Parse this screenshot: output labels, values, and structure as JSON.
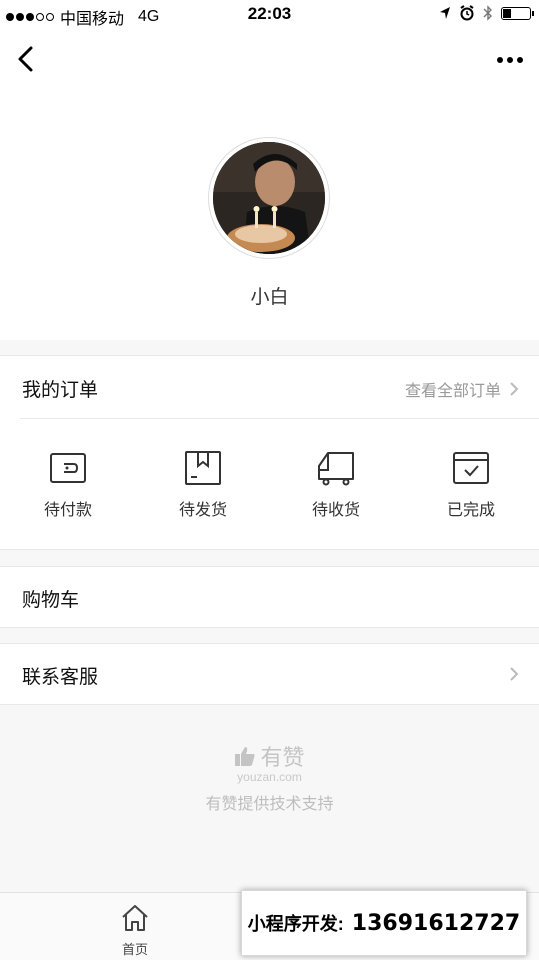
{
  "status_bar": {
    "carrier": "中国移动",
    "network": "4G",
    "time": "22:03"
  },
  "profile": {
    "username": "小白"
  },
  "orders": {
    "title": "我的订单",
    "view_all": "查看全部订单",
    "statuses": [
      {
        "label": "待付款",
        "icon": "wallet-icon"
      },
      {
        "label": "待发货",
        "icon": "package-icon"
      },
      {
        "label": "待收货",
        "icon": "truck-icon"
      },
      {
        "label": "已完成",
        "icon": "check-box-icon"
      }
    ]
  },
  "cart": {
    "label": "购物车"
  },
  "service": {
    "label": "联系客服"
  },
  "footer": {
    "brand_name": "有赞",
    "brand_domain": "youzan.com",
    "support_text": "有赞提供技术支持"
  },
  "tab_bar": {
    "home_label": "首页"
  },
  "banner": {
    "label": "小程序开发:",
    "phone": "13691612727"
  }
}
